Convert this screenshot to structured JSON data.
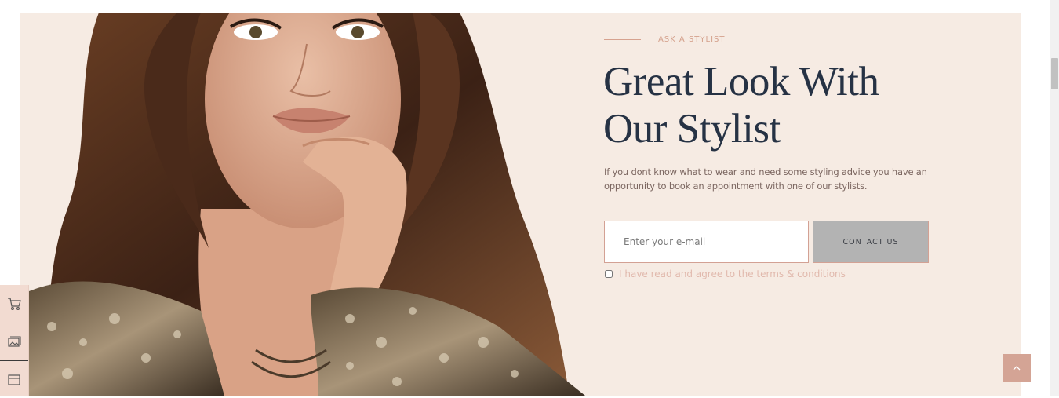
{
  "hero": {
    "eyebrow": "ASK A STYLIST",
    "heading_line1": "Great Look With",
    "heading_line2": "Our Stylist",
    "description": "If you dont know what to wear and need some styling advice you have an opportunity to book an appointment with one of our stylists.",
    "image_alt": "model photo"
  },
  "form": {
    "email_placeholder": "Enter your e-mail",
    "email_value": "",
    "button_label": "CONTACT US",
    "terms_label": "I have read and agree to the terms & conditions",
    "terms_checked": false
  },
  "side_panel": {
    "items": [
      {
        "icon": "cart-icon"
      },
      {
        "icon": "gallery-icon"
      },
      {
        "icon": "browser-window-icon"
      }
    ]
  },
  "back_to_top": {
    "icon": "chevron-up-icon"
  },
  "colors": {
    "hero_background": "#f6ebe3",
    "heading": "#263244",
    "accent": "#d4a495",
    "button_background": "#b3b3b3"
  }
}
